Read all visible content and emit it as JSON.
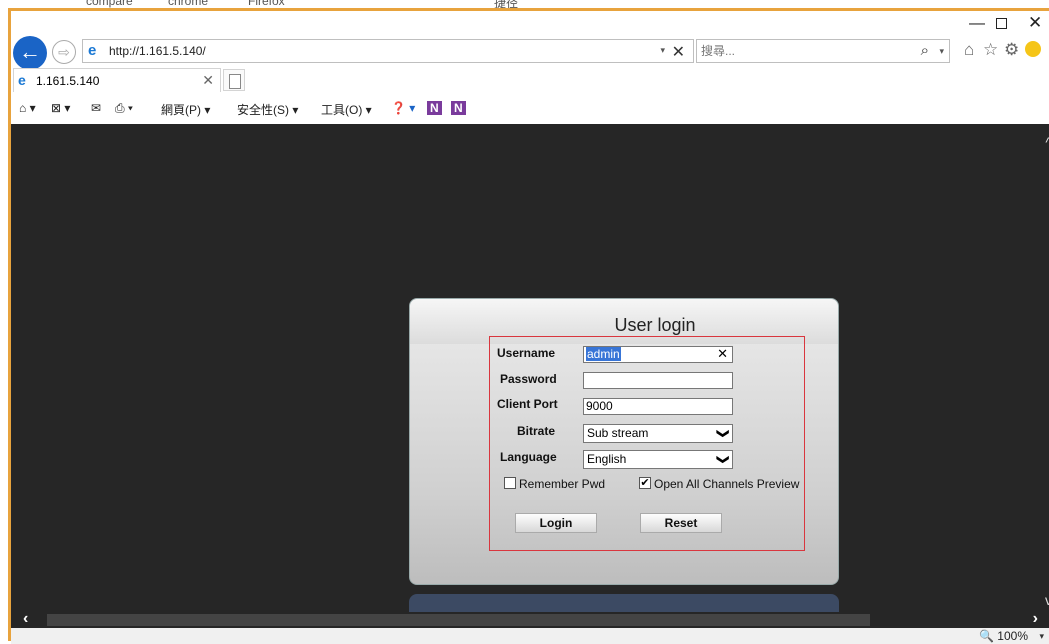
{
  "desktop_strip": {
    "items": [
      "compare",
      "chrome",
      "Firefox",
      "捷径"
    ]
  },
  "browser": {
    "url": "http://1.161.5.140/",
    "search_placeholder": "搜尋...",
    "tab_title": "1.161.5.140",
    "window_controls": {
      "minimize": "—",
      "maximize": "",
      "close": "✕"
    },
    "icons": {
      "back": "←",
      "forward": "⇨",
      "home": "⌂",
      "favorites": "☆",
      "tools": "⚙",
      "search": "⌕",
      "url_dropdown": "▾",
      "url_clear": "✕",
      "search_dropdown": "▾",
      "tab_close": "✕"
    },
    "command_bar": [
      {
        "label": "⌂ ▾",
        "name": "home-cmd"
      },
      {
        "label": "⊠ ▾",
        "name": "feeds-cmd"
      },
      {
        "label": "✉",
        "name": "mail-cmd"
      },
      {
        "label": "⎙ ▾",
        "name": "print-cmd"
      },
      {
        "label": "網頁(P) ▾",
        "name": "page-menu"
      },
      {
        "label": "安全性(S) ▾",
        "name": "safety-menu"
      },
      {
        "label": "工具(O) ▾",
        "name": "tools-menu"
      },
      {
        "label": "❓ ▾",
        "name": "help-menu"
      },
      {
        "label": "N",
        "name": "onenote-icon-1"
      },
      {
        "label": "N",
        "name": "onenote-icon-2"
      }
    ],
    "zoom": "100%",
    "zoom_icon": "🔍",
    "zoom_dropdown": "▾",
    "scroll_left": "‹",
    "scroll_right": "›",
    "scroll_up": "^",
    "scroll_down": "v"
  },
  "login": {
    "title": "User login",
    "fields": {
      "username_label": "Username",
      "username_value": "admin",
      "password_label": "Password",
      "password_value": "",
      "client_port_label": "Client Port",
      "client_port_value": "9000",
      "bitrate_label": "Bitrate",
      "bitrate_value": "Sub stream",
      "language_label": "Language",
      "language_value": "English"
    },
    "remember_pwd_label": "Remember Pwd",
    "remember_pwd_checked": false,
    "open_all_label": "Open All Channels Preview",
    "open_all_checked": true,
    "checkmark": "✔",
    "clear_x": "✕",
    "dropdown_arrow": "❯",
    "login_button": "Login",
    "reset_button": "Reset"
  },
  "colors": {
    "content_bg": "#262626",
    "accent_frame": "#d9363e",
    "window_border": "#e8a33d",
    "ie_blue": "#1a64c6"
  }
}
